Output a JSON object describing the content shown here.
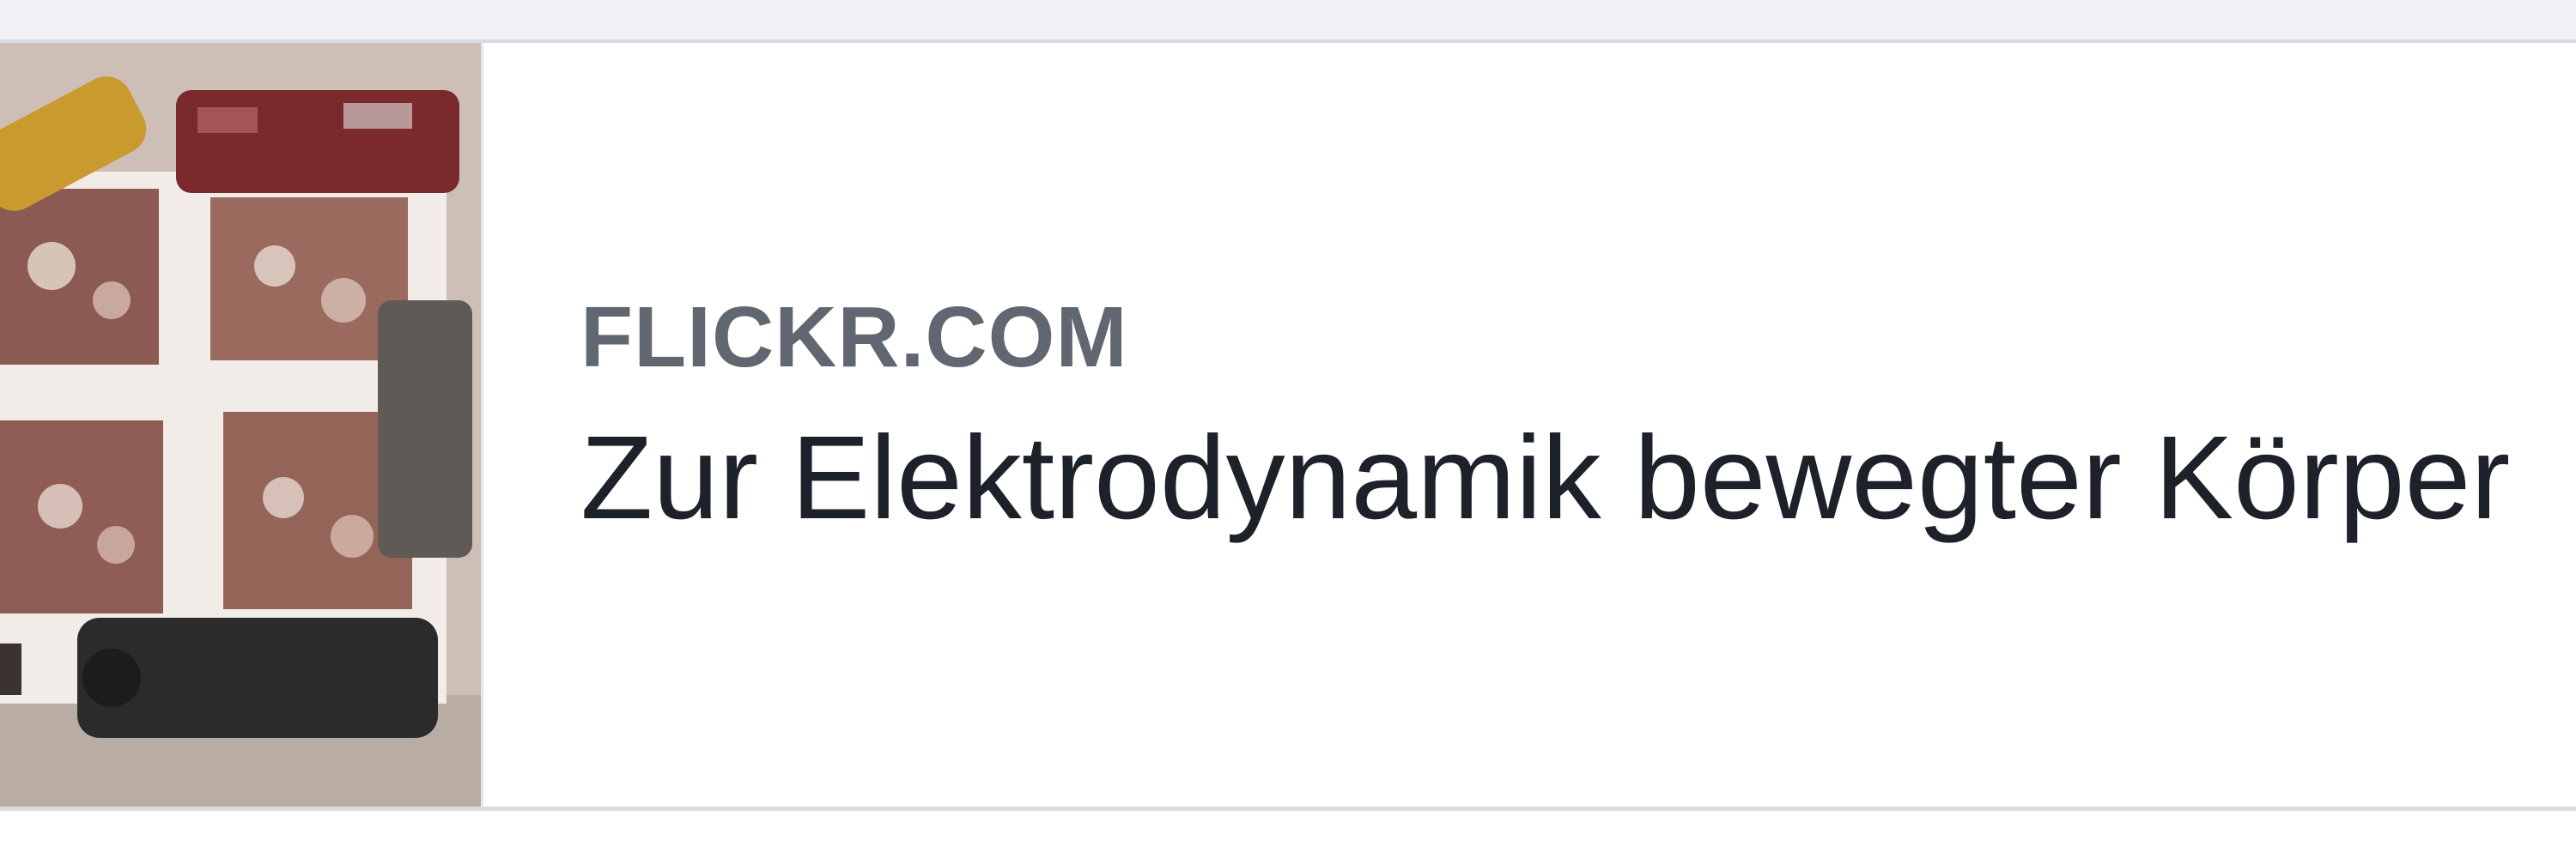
{
  "link_preview": {
    "domain": "FLICKR.COM",
    "title": "Zur Elektrodynamik bewegter Körper",
    "thumbnail_icon": "photo-thumbnail-model-trains"
  }
}
